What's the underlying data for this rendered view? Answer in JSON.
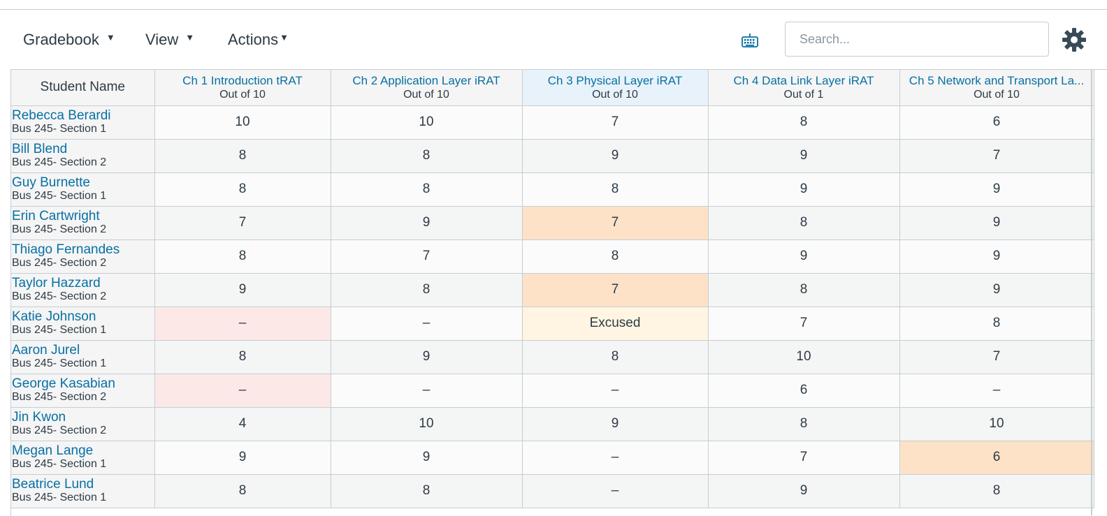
{
  "toolbar": {
    "gradebook_label": "Gradebook",
    "view_label": "View",
    "actions_label": "Actions",
    "search_placeholder": "Search...",
    "keyboard_icon": "keyboard-icon",
    "settings_icon": "gear-icon"
  },
  "colors": {
    "link": "#0770a3",
    "missing": "#fde8e8",
    "late": "#fde2c8",
    "excused": "#fff5e2"
  },
  "grid": {
    "student_header": "Student Name",
    "columns": [
      {
        "title": "Ch 1 Introduction tRAT",
        "subtitle": "Out of 10"
      },
      {
        "title": "Ch 2 Application Layer iRAT",
        "subtitle": "Out of 10"
      },
      {
        "title": "Ch 3 Physical Layer iRAT",
        "subtitle": "Out of 10",
        "active": true
      },
      {
        "title": "Ch 4 Data Link Layer iRAT",
        "subtitle": "Out of 1"
      },
      {
        "title": "Ch 5 Network and Transport La...",
        "subtitle": "Out of 10"
      }
    ],
    "rows": [
      {
        "name": "Rebecca Berardi",
        "section": "Bus 245- Section 1",
        "grades": [
          "10",
          "10",
          "7",
          "8",
          "6"
        ],
        "status": [
          "",
          "",
          "",
          "",
          ""
        ]
      },
      {
        "name": "Bill Blend",
        "section": "Bus 245- Section 2",
        "grades": [
          "8",
          "8",
          "9",
          "9",
          "7"
        ],
        "status": [
          "",
          "",
          "",
          "",
          ""
        ]
      },
      {
        "name": "Guy Burnette",
        "section": "Bus 245- Section 1",
        "grades": [
          "8",
          "8",
          "8",
          "9",
          "9"
        ],
        "status": [
          "",
          "",
          "",
          "",
          ""
        ]
      },
      {
        "name": "Erin Cartwright",
        "section": "Bus 245- Section 2",
        "grades": [
          "7",
          "9",
          "7",
          "8",
          "9"
        ],
        "status": [
          "",
          "",
          "late",
          "",
          ""
        ]
      },
      {
        "name": "Thiago Fernandes",
        "section": "Bus 245- Section 2",
        "grades": [
          "8",
          "7",
          "8",
          "9",
          "9"
        ],
        "status": [
          "",
          "",
          "",
          "",
          ""
        ]
      },
      {
        "name": "Taylor Hazzard",
        "section": "Bus 245- Section 2",
        "grades": [
          "9",
          "8",
          "7",
          "8",
          "9"
        ],
        "status": [
          "",
          "",
          "late",
          "",
          ""
        ]
      },
      {
        "name": "Katie Johnson",
        "section": "Bus 245- Section 1",
        "grades": [
          "–",
          "–",
          "Excused",
          "7",
          "8"
        ],
        "status": [
          "missing",
          "",
          "excused",
          "",
          ""
        ]
      },
      {
        "name": "Aaron Jurel",
        "section": "Bus 245- Section 1",
        "grades": [
          "8",
          "9",
          "8",
          "10",
          "7"
        ],
        "status": [
          "",
          "",
          "",
          "",
          ""
        ]
      },
      {
        "name": "George Kasabian",
        "section": "Bus 245- Section 2",
        "grades": [
          "–",
          "–",
          "–",
          "6",
          "–"
        ],
        "status": [
          "missing",
          "",
          "",
          "",
          ""
        ]
      },
      {
        "name": "Jin Kwon",
        "section": "Bus 245- Section 2",
        "grades": [
          "4",
          "10",
          "9",
          "8",
          "10"
        ],
        "status": [
          "",
          "",
          "",
          "",
          ""
        ]
      },
      {
        "name": "Megan Lange",
        "section": "Bus 245- Section 1",
        "grades": [
          "9",
          "9",
          "–",
          "7",
          "6"
        ],
        "status": [
          "",
          "",
          "",
          "",
          "late"
        ]
      },
      {
        "name": "Beatrice Lund",
        "section": "Bus 245- Section 1",
        "grades": [
          "8",
          "8",
          "–",
          "9",
          "8"
        ],
        "status": [
          "",
          "",
          "",
          "",
          ""
        ]
      }
    ]
  }
}
